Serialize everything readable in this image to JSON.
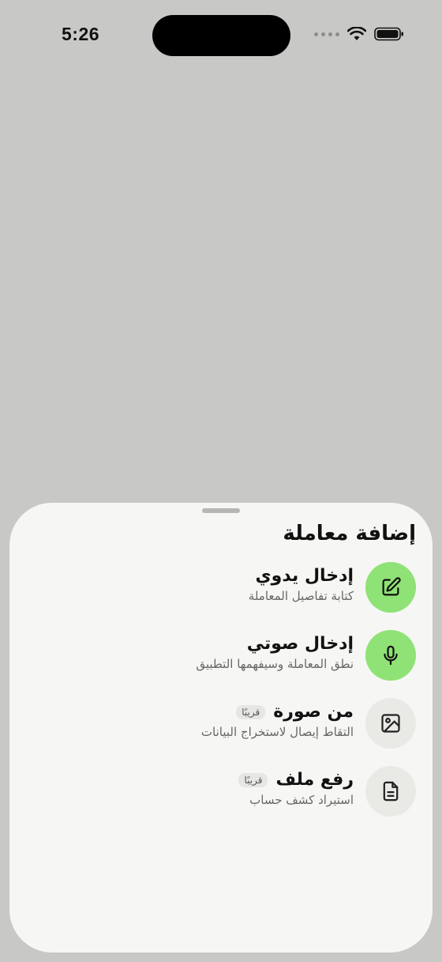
{
  "status_bar": {
    "time": "5:26"
  },
  "sheet": {
    "title": "إضافة معاملة",
    "options": [
      {
        "title": "إدخال يدوي",
        "subtitle": "كتابة تفاصيل المعاملة",
        "badge": "",
        "icon": "edit-icon",
        "active": true
      },
      {
        "title": "إدخال صوتي",
        "subtitle": "نطق المعاملة وسيفهمها التطبيق",
        "badge": "",
        "icon": "microphone-icon",
        "active": true
      },
      {
        "title": "من صورة",
        "subtitle": "التقاط إيصال لاستخراج البيانات",
        "badge": "قريبًا",
        "icon": "image-icon",
        "active": false
      },
      {
        "title": "رفع ملف",
        "subtitle": "استيراد كشف حساب",
        "badge": "قريبًا",
        "icon": "file-icon",
        "active": false
      }
    ]
  },
  "colors": {
    "accent": "#8fe275",
    "sheet_bg": "#f6f6f4",
    "backdrop": "#c8c8c6"
  }
}
